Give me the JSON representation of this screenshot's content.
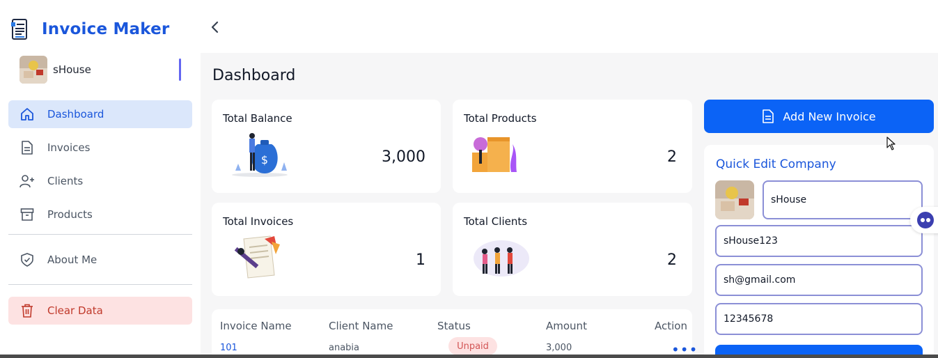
{
  "app": {
    "title": "Invoice Maker"
  },
  "profile": {
    "name": "sHouse"
  },
  "sidebar": {
    "items": [
      {
        "label": "Dashboard",
        "icon": "home-icon"
      },
      {
        "label": "Invoices",
        "icon": "document-icon"
      },
      {
        "label": "Clients",
        "icon": "add-user-icon"
      },
      {
        "label": "Products",
        "icon": "archive-icon"
      },
      {
        "label": "About Me",
        "icon": "shield-icon"
      },
      {
        "label": "Clear Data",
        "icon": "trash-icon"
      }
    ]
  },
  "main": {
    "title": "Dashboard",
    "stats": [
      {
        "label": "Total Balance",
        "value": "3,000"
      },
      {
        "label": "Total Products",
        "value": "2"
      },
      {
        "label": "Total Invoices",
        "value": "1"
      },
      {
        "label": "Total Clients",
        "value": "2"
      }
    ],
    "table": {
      "headers": [
        "Invoice Name",
        "Client Name",
        "Status",
        "Amount",
        "Action"
      ],
      "rows": [
        {
          "invoice": "101",
          "client": "anabia",
          "status": "Unpaid",
          "amount": "3,000",
          "action": "•••"
        }
      ]
    }
  },
  "actions": {
    "add_invoice": "Add New Invoice"
  },
  "quick_edit": {
    "title": "Quick Edit Company",
    "name": "sHouse",
    "id": "sHouse123",
    "email": "sh@gmail.com",
    "phone": "12345678"
  },
  "colors": {
    "brand": "#1a56db",
    "primary_button": "#0b63f6",
    "active_nav": "#dbe7fb",
    "danger_bg": "#fde2e2",
    "unpaid_badge": "#fde2e2"
  }
}
